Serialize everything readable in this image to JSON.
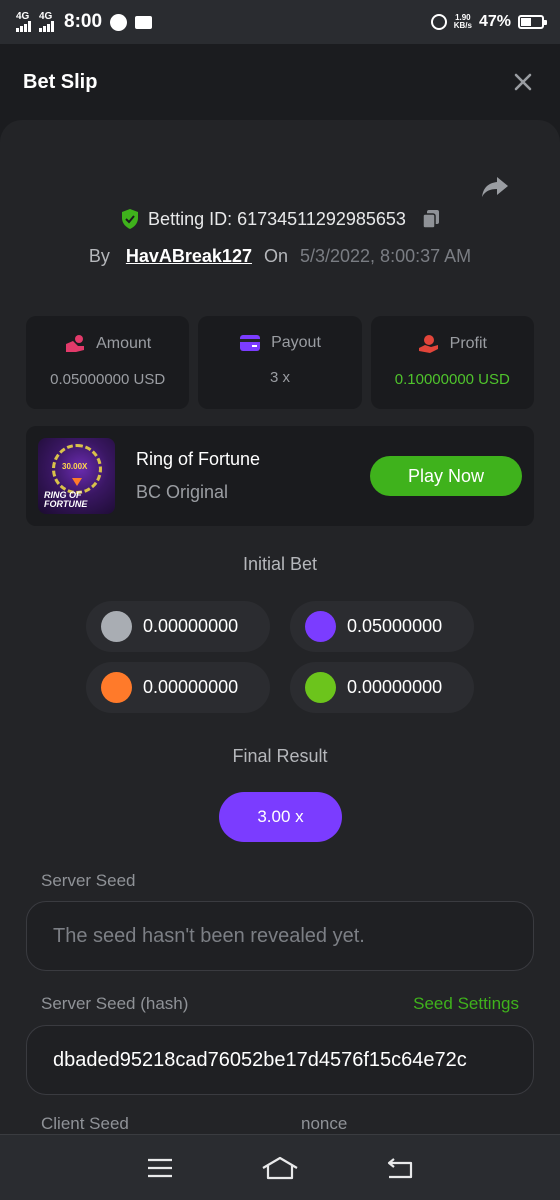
{
  "status_bar": {
    "net1": "4G",
    "net2": "4G",
    "time": "8:00",
    "speed_value": "1.90",
    "speed_unit": "KB/s",
    "battery": "47%",
    "icons": [
      "signal-icon",
      "messenger-icon",
      "mail-icon",
      "alarm-icon",
      "battery-icon"
    ]
  },
  "header": {
    "title": "Bet Slip",
    "close_icon": "close-icon"
  },
  "bet": {
    "betting_id_label": "Betting ID: 617345112929856​53",
    "by_label": "By",
    "user": "HavABreak127",
    "on_label": "On",
    "date": "5/3/2022, 8:00:37 AM",
    "verified_color": "#3fb21c"
  },
  "stats": [
    {
      "label": "Amount",
      "value": "0.05000000 USD",
      "icon": "wallet-hand-icon",
      "icon_color": "#e23a6a"
    },
    {
      "label": "Payout",
      "value": "3 x",
      "icon": "card-icon",
      "icon_color": "#7b3cff"
    },
    {
      "label": "Profit",
      "value": "0.10000000 USD",
      "icon": "profit-hand-icon",
      "icon_color": "#e2453a",
      "value_color": "#4fc32c"
    }
  ],
  "game": {
    "thumb_multiplier": "30.00X",
    "thumb_logo_line1": "RING OF",
    "thumb_logo_line2": "FORTUNE",
    "name": "Ring of Fortune",
    "subtitle": "BC Original",
    "play_label": "Play Now"
  },
  "initial_bet": {
    "label": "Initial Bet",
    "chips": [
      {
        "color": "#a9adb3",
        "value": "0.00000000"
      },
      {
        "color": "#7b3cff",
        "value": "0.05000000"
      },
      {
        "color": "#ff7a2a",
        "value": "0.00000000"
      },
      {
        "color": "#6cc41c",
        "value": "0.00000000"
      }
    ]
  },
  "final_result": {
    "label": "Final Result",
    "value": "3.00 x"
  },
  "seeds": {
    "server_seed_label": "Server Seed",
    "server_seed_placeholder": "The seed hasn't been revealed yet.",
    "server_seed_hash_label": "Server Seed (hash)",
    "seed_settings_label": "Seed Settings",
    "server_seed_hash_value": "dbaded95218cad76052be17d4576f15c64e72c",
    "client_seed_label": "Client Seed",
    "nonce_label": "nonce"
  },
  "nav": {
    "icons": [
      "menu-icon",
      "home-icon",
      "back-icon"
    ]
  }
}
